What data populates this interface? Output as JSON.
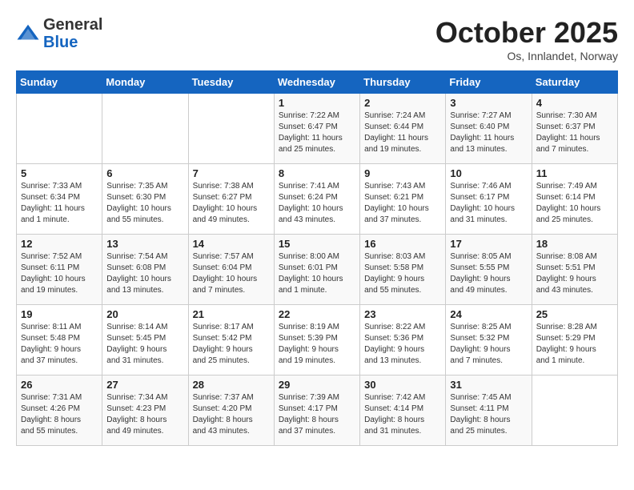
{
  "header": {
    "logo_general": "General",
    "logo_blue": "Blue",
    "month": "October 2025",
    "location": "Os, Innlandet, Norway"
  },
  "days_of_week": [
    "Sunday",
    "Monday",
    "Tuesday",
    "Wednesday",
    "Thursday",
    "Friday",
    "Saturday"
  ],
  "weeks": [
    [
      {
        "day": "",
        "info": ""
      },
      {
        "day": "",
        "info": ""
      },
      {
        "day": "",
        "info": ""
      },
      {
        "day": "1",
        "info": "Sunrise: 7:22 AM\nSunset: 6:47 PM\nDaylight: 11 hours\nand 25 minutes."
      },
      {
        "day": "2",
        "info": "Sunrise: 7:24 AM\nSunset: 6:44 PM\nDaylight: 11 hours\nand 19 minutes."
      },
      {
        "day": "3",
        "info": "Sunrise: 7:27 AM\nSunset: 6:40 PM\nDaylight: 11 hours\nand 13 minutes."
      },
      {
        "day": "4",
        "info": "Sunrise: 7:30 AM\nSunset: 6:37 PM\nDaylight: 11 hours\nand 7 minutes."
      }
    ],
    [
      {
        "day": "5",
        "info": "Sunrise: 7:33 AM\nSunset: 6:34 PM\nDaylight: 11 hours\nand 1 minute."
      },
      {
        "day": "6",
        "info": "Sunrise: 7:35 AM\nSunset: 6:30 PM\nDaylight: 10 hours\nand 55 minutes."
      },
      {
        "day": "7",
        "info": "Sunrise: 7:38 AM\nSunset: 6:27 PM\nDaylight: 10 hours\nand 49 minutes."
      },
      {
        "day": "8",
        "info": "Sunrise: 7:41 AM\nSunset: 6:24 PM\nDaylight: 10 hours\nand 43 minutes."
      },
      {
        "day": "9",
        "info": "Sunrise: 7:43 AM\nSunset: 6:21 PM\nDaylight: 10 hours\nand 37 minutes."
      },
      {
        "day": "10",
        "info": "Sunrise: 7:46 AM\nSunset: 6:17 PM\nDaylight: 10 hours\nand 31 minutes."
      },
      {
        "day": "11",
        "info": "Sunrise: 7:49 AM\nSunset: 6:14 PM\nDaylight: 10 hours\nand 25 minutes."
      }
    ],
    [
      {
        "day": "12",
        "info": "Sunrise: 7:52 AM\nSunset: 6:11 PM\nDaylight: 10 hours\nand 19 minutes."
      },
      {
        "day": "13",
        "info": "Sunrise: 7:54 AM\nSunset: 6:08 PM\nDaylight: 10 hours\nand 13 minutes."
      },
      {
        "day": "14",
        "info": "Sunrise: 7:57 AM\nSunset: 6:04 PM\nDaylight: 10 hours\nand 7 minutes."
      },
      {
        "day": "15",
        "info": "Sunrise: 8:00 AM\nSunset: 6:01 PM\nDaylight: 10 hours\nand 1 minute."
      },
      {
        "day": "16",
        "info": "Sunrise: 8:03 AM\nSunset: 5:58 PM\nDaylight: 9 hours\nand 55 minutes."
      },
      {
        "day": "17",
        "info": "Sunrise: 8:05 AM\nSunset: 5:55 PM\nDaylight: 9 hours\nand 49 minutes."
      },
      {
        "day": "18",
        "info": "Sunrise: 8:08 AM\nSunset: 5:51 PM\nDaylight: 9 hours\nand 43 minutes."
      }
    ],
    [
      {
        "day": "19",
        "info": "Sunrise: 8:11 AM\nSunset: 5:48 PM\nDaylight: 9 hours\nand 37 minutes."
      },
      {
        "day": "20",
        "info": "Sunrise: 8:14 AM\nSunset: 5:45 PM\nDaylight: 9 hours\nand 31 minutes."
      },
      {
        "day": "21",
        "info": "Sunrise: 8:17 AM\nSunset: 5:42 PM\nDaylight: 9 hours\nand 25 minutes."
      },
      {
        "day": "22",
        "info": "Sunrise: 8:19 AM\nSunset: 5:39 PM\nDaylight: 9 hours\nand 19 minutes."
      },
      {
        "day": "23",
        "info": "Sunrise: 8:22 AM\nSunset: 5:36 PM\nDaylight: 9 hours\nand 13 minutes."
      },
      {
        "day": "24",
        "info": "Sunrise: 8:25 AM\nSunset: 5:32 PM\nDaylight: 9 hours\nand 7 minutes."
      },
      {
        "day": "25",
        "info": "Sunrise: 8:28 AM\nSunset: 5:29 PM\nDaylight: 9 hours\nand 1 minute."
      }
    ],
    [
      {
        "day": "26",
        "info": "Sunrise: 7:31 AM\nSunset: 4:26 PM\nDaylight: 8 hours\nand 55 minutes."
      },
      {
        "day": "27",
        "info": "Sunrise: 7:34 AM\nSunset: 4:23 PM\nDaylight: 8 hours\nand 49 minutes."
      },
      {
        "day": "28",
        "info": "Sunrise: 7:37 AM\nSunset: 4:20 PM\nDaylight: 8 hours\nand 43 minutes."
      },
      {
        "day": "29",
        "info": "Sunrise: 7:39 AM\nSunset: 4:17 PM\nDaylight: 8 hours\nand 37 minutes."
      },
      {
        "day": "30",
        "info": "Sunrise: 7:42 AM\nSunset: 4:14 PM\nDaylight: 8 hours\nand 31 minutes."
      },
      {
        "day": "31",
        "info": "Sunrise: 7:45 AM\nSunset: 4:11 PM\nDaylight: 8 hours\nand 25 minutes."
      },
      {
        "day": "",
        "info": ""
      }
    ]
  ]
}
